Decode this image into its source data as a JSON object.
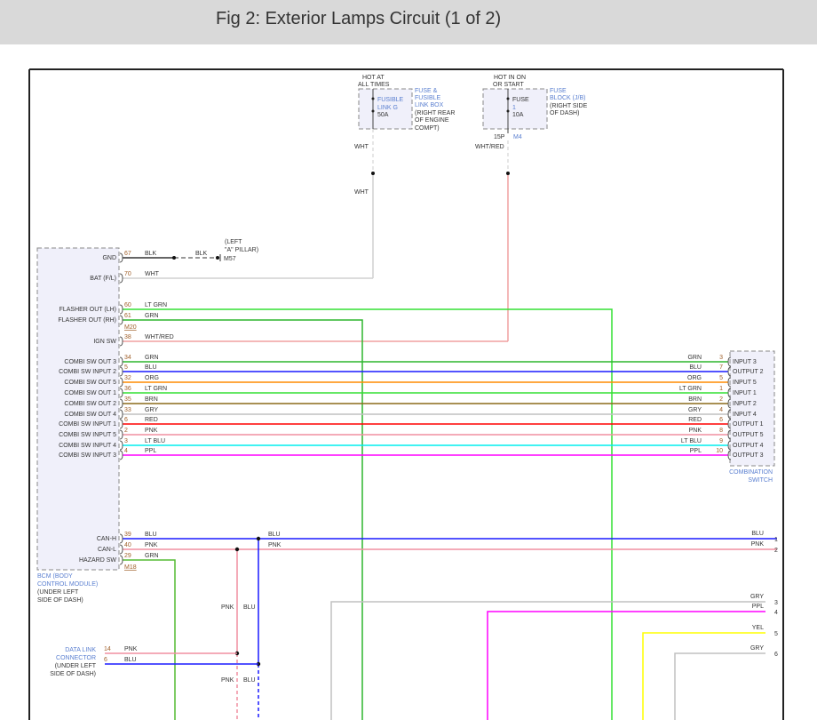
{
  "title": "Fig 2: Exterior Lamps Circuit (1 of 2)",
  "fuse_link": {
    "supply": [
      "HOT AT",
      "ALL TIMES"
    ],
    "name": [
      "FUSIBLE",
      "LINK G"
    ],
    "rating": "50A",
    "box": [
      "FUSE &",
      "FUSIBLE",
      "LINK BOX"
    ],
    "location": [
      "(RIGHT REAR",
      "OF ENGINE",
      "COMPT)"
    ],
    "wire": "WHT",
    "wire2": "WHT"
  },
  "fuse_block": {
    "supply": [
      "HOT IN ON",
      "OR START"
    ],
    "name": [
      "FUSE",
      "1"
    ],
    "rating": "10A",
    "box": [
      "FUSE",
      "BLOCK (J/B)"
    ],
    "location": [
      "(RIGHT SIDE",
      "OF DASH)"
    ],
    "pin": "15P",
    "connector": "M4",
    "wire": "WHT/RED"
  },
  "ground": {
    "pin": "67",
    "wire": "BLK",
    "wire2": "BLK",
    "location": [
      "(LEFT",
      "\"A\" PILLAR)"
    ],
    "connector": "M57"
  },
  "bcm": {
    "name": [
      "BCM (BODY",
      "CONTROL MODULE)"
    ],
    "location": [
      "(UNDER LEFT",
      "SIDE OF DASH)"
    ],
    "connector_m20": "M20",
    "connector_m18": "M18",
    "pins": [
      {
        "label": "GND",
        "pin": "67",
        "wire": "BLK"
      },
      {
        "label": "BAT (F/L)",
        "pin": "70",
        "wire": "WHT"
      },
      {
        "label": "FLASHER OUT (LH)",
        "pin": "60",
        "wire": "LT GRN"
      },
      {
        "label": "FLASHER OUT (RH)",
        "pin": "61",
        "wire": "GRN"
      },
      {
        "label": "IGN SW",
        "pin": "38",
        "wire": "WHT/RED"
      },
      {
        "label": "CAN-H",
        "pin": "39",
        "wire": "BLU"
      },
      {
        "label": "CAN-L",
        "pin": "40",
        "wire": "PNK"
      },
      {
        "label": "HAZARD SW",
        "pin": "29",
        "wire": "GRN"
      }
    ]
  },
  "combi": [
    {
      "bcm_label": "COMBI SW OUT 3",
      "bcm_pin": "34",
      "wire": "GRN",
      "color": "#2db52d",
      "sw_pin": "3",
      "sw_label": "INPUT 3"
    },
    {
      "bcm_label": "COMBI SW INPUT 2",
      "bcm_pin": "5",
      "wire": "BLU",
      "color": "#1a1aff",
      "sw_pin": "7",
      "sw_label": "OUTPUT 2"
    },
    {
      "bcm_label": "COMBI SW OUT 5",
      "bcm_pin": "32",
      "wire": "ORG",
      "color": "#ff8c00",
      "sw_pin": "5",
      "sw_label": "INPUT 5"
    },
    {
      "bcm_label": "COMBI SW OUT 1",
      "bcm_pin": "36",
      "wire": "LT GRN",
      "color": "#33e033",
      "sw_pin": "1",
      "sw_label": "INPUT 1"
    },
    {
      "bcm_label": "COMBI SW OUT 2",
      "bcm_pin": "35",
      "wire": "BRN",
      "color": "#8b6b1a",
      "sw_pin": "2",
      "sw_label": "INPUT 2"
    },
    {
      "bcm_label": "COMBI SW OUT 4",
      "bcm_pin": "33",
      "wire": "GRY",
      "color": "#c0c0c0",
      "sw_pin": "4",
      "sw_label": "INPUT 4"
    },
    {
      "bcm_label": "COMBI SW INPUT 1",
      "bcm_pin": "6",
      "wire": "RED",
      "color": "#ff0000",
      "sw_pin": "6",
      "sw_label": "OUTPUT 1"
    },
    {
      "bcm_label": "COMBI SW INPUT 5",
      "bcm_pin": "2",
      "wire": "PNK",
      "color": "#f08fa0",
      "sw_pin": "8",
      "sw_label": "OUTPUT 5"
    },
    {
      "bcm_label": "COMBI SW INPUT 4",
      "bcm_pin": "3",
      "wire": "LT BLU",
      "color": "#00eeee",
      "sw_pin": "9",
      "sw_label": "OUTPUT 4"
    },
    {
      "bcm_label": "COMBI SW INPUT 3",
      "bcm_pin": "4",
      "wire": "PPL",
      "color": "#ff00ff",
      "sw_pin": "10",
      "sw_label": "OUTPUT 3"
    }
  ],
  "combination_switch": [
    "COMBINATION",
    "SWITCH"
  ],
  "dlc": {
    "name": [
      "DATA LINK",
      "CONNECTOR"
    ],
    "location": [
      "(UNDER LEFT",
      "SIDE OF DASH)"
    ],
    "pins": [
      {
        "pin": "14",
        "wire": "PNK"
      },
      {
        "pin": "6",
        "wire": "BLU"
      }
    ]
  },
  "can_right": {
    "blu": "BLU",
    "pnk": "PNK",
    "vert_pnk": "PNK",
    "vert_blu": "BLU",
    "vert_pnk2": "PNK",
    "vert_blu2": "BLU"
  },
  "right_outputs": [
    {
      "wire": "BLU",
      "pin": "1",
      "color": "#1a1aff"
    },
    {
      "wire": "PNK",
      "pin": "2",
      "color": "#f08fa0"
    },
    {
      "wire": "GRY",
      "pin": "3",
      "color": "#c0c0c0"
    },
    {
      "wire": "PPL",
      "pin": "4",
      "color": "#ff00ff"
    },
    {
      "wire": "YEL",
      "pin": "5",
      "color": "#ffff00"
    },
    {
      "wire": "GRY",
      "pin": "6",
      "color": "#c0c0c0"
    }
  ]
}
